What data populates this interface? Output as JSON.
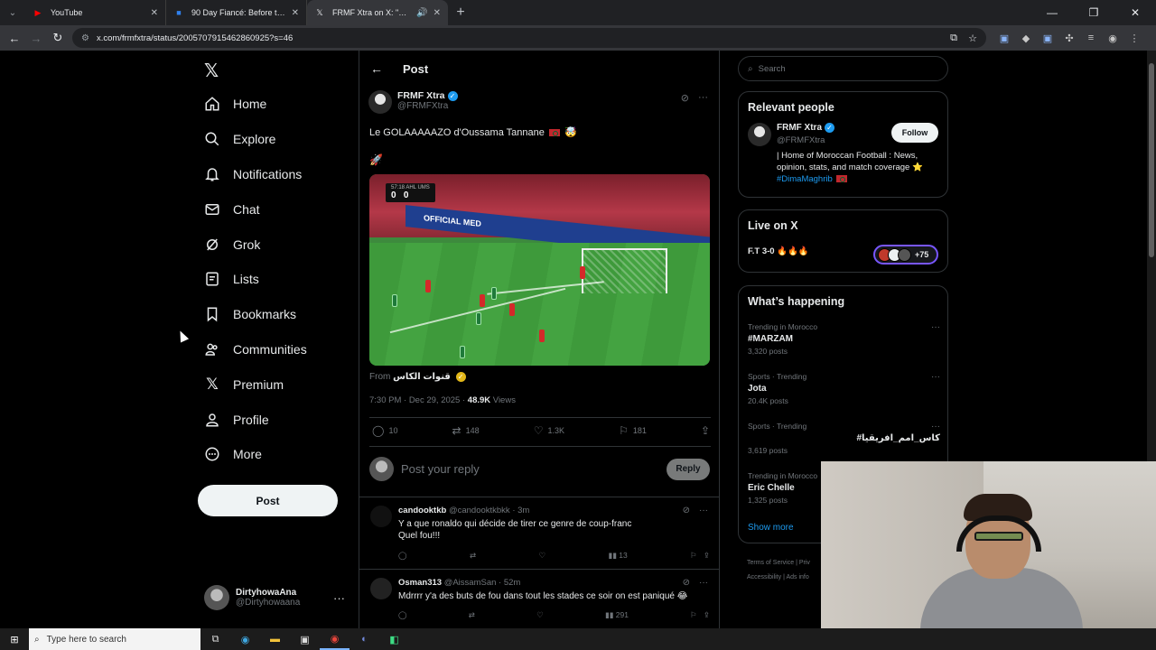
{
  "browser": {
    "tabs": [
      {
        "title": "YouTube",
        "active": false,
        "icon": "youtube-icon"
      },
      {
        "title": "90 Day Fiancé: Before the 90 Da",
        "active": false,
        "icon": "streaming-icon"
      },
      {
        "title": "FRMF Xtra on X: \"Le GOLAA",
        "active": true,
        "icon": "x-logo-icon"
      }
    ],
    "url": "x.com/frmfxtra/status/2005707915462860925?s=46"
  },
  "nav": {
    "items": [
      {
        "label": "Home",
        "icon": "home-icon"
      },
      {
        "label": "Explore",
        "icon": "search-icon"
      },
      {
        "label": "Notifications",
        "icon": "bell-icon"
      },
      {
        "label": "Chat",
        "icon": "mail-icon"
      },
      {
        "label": "Grok",
        "icon": "grok-icon"
      },
      {
        "label": "Lists",
        "icon": "list-icon"
      },
      {
        "label": "Bookmarks",
        "icon": "bookmark-icon"
      },
      {
        "label": "Communities",
        "icon": "people-icon"
      },
      {
        "label": "Premium",
        "icon": "x-logo-icon"
      },
      {
        "label": "Profile",
        "icon": "person-icon"
      },
      {
        "label": "More",
        "icon": "more-circle-icon"
      }
    ],
    "post_label": "Post",
    "account": {
      "name": "DirtyhowaAna",
      "handle": "@Dirtyhowaana"
    }
  },
  "main": {
    "header": "Post",
    "tweet": {
      "author": "FRMF Xtra",
      "handle": "@FRMFXtra",
      "text": "Le GOLAAAAAZO d'Oussama Tannane",
      "emoji_rocket": "🚀",
      "emoji_face": "🤯",
      "from_label": "From",
      "from_source": "قنوات الكاس",
      "time": "7:30 PM · Dec 29, 2025 · ",
      "views_count": "48.9K",
      "views_label": " Views",
      "stats": {
        "replies": "10",
        "reposts": "148",
        "likes": "1.3K",
        "bookmarks": "181"
      },
      "video_score_home": "0",
      "video_score_away": "0",
      "video_clock": "57:18  AHL  UMS",
      "video_banner": "OFFICIAL MED"
    },
    "reply_placeholder": "Post your reply",
    "reply_button": "Reply",
    "replies": [
      {
        "name": "candooktkb",
        "meta": "@candooktkbkk · 3m",
        "line1": "Y a que ronaldo qui décide de tirer ce genre de coup-franc",
        "line2": "Quel fou!!!",
        "views": "13"
      },
      {
        "name": "Osman313",
        "meta": "@AissamSan · 52m",
        "line1": "Mdrrrr y'a des buts de fou dans tout les stades ce soir on est paniqué 😂",
        "line2": "",
        "views": "291"
      }
    ]
  },
  "right": {
    "search_placeholder": "Search",
    "relevant": {
      "title": "Relevant people",
      "name": "FRMF Xtra",
      "handle": "@FRMFXtra",
      "follow": "Follow",
      "bio": "| Home of Moroccan Football : News, opinion, stats, and match coverage ⭐",
      "bio_tag": "#DimaMaghrib"
    },
    "live": {
      "title": "Live on X",
      "item": "F.T 3-0 🔥🔥🔥",
      "count": "+75"
    },
    "happening": {
      "title": "What’s happening",
      "trends": [
        {
          "context": "Trending in Morocco",
          "name": "#MARZAM",
          "count": "3,320 posts"
        },
        {
          "context": "Sports · Trending",
          "name": "Jota",
          "count": "20.4K posts"
        },
        {
          "context": "Sports · Trending",
          "name": "#كاس_امم_افريقيا",
          "count": "3,619 posts"
        },
        {
          "context": "Trending in Morocco",
          "name": "Eric Chelle",
          "count": "1,325 posts"
        }
      ],
      "show_more": "Show more"
    },
    "footer": {
      "line1": "Terms of Service  |  Priv",
      "line2": "Accessibility  |  Ads info"
    }
  },
  "taskbar": {
    "search_placeholder": "Type here to search"
  }
}
